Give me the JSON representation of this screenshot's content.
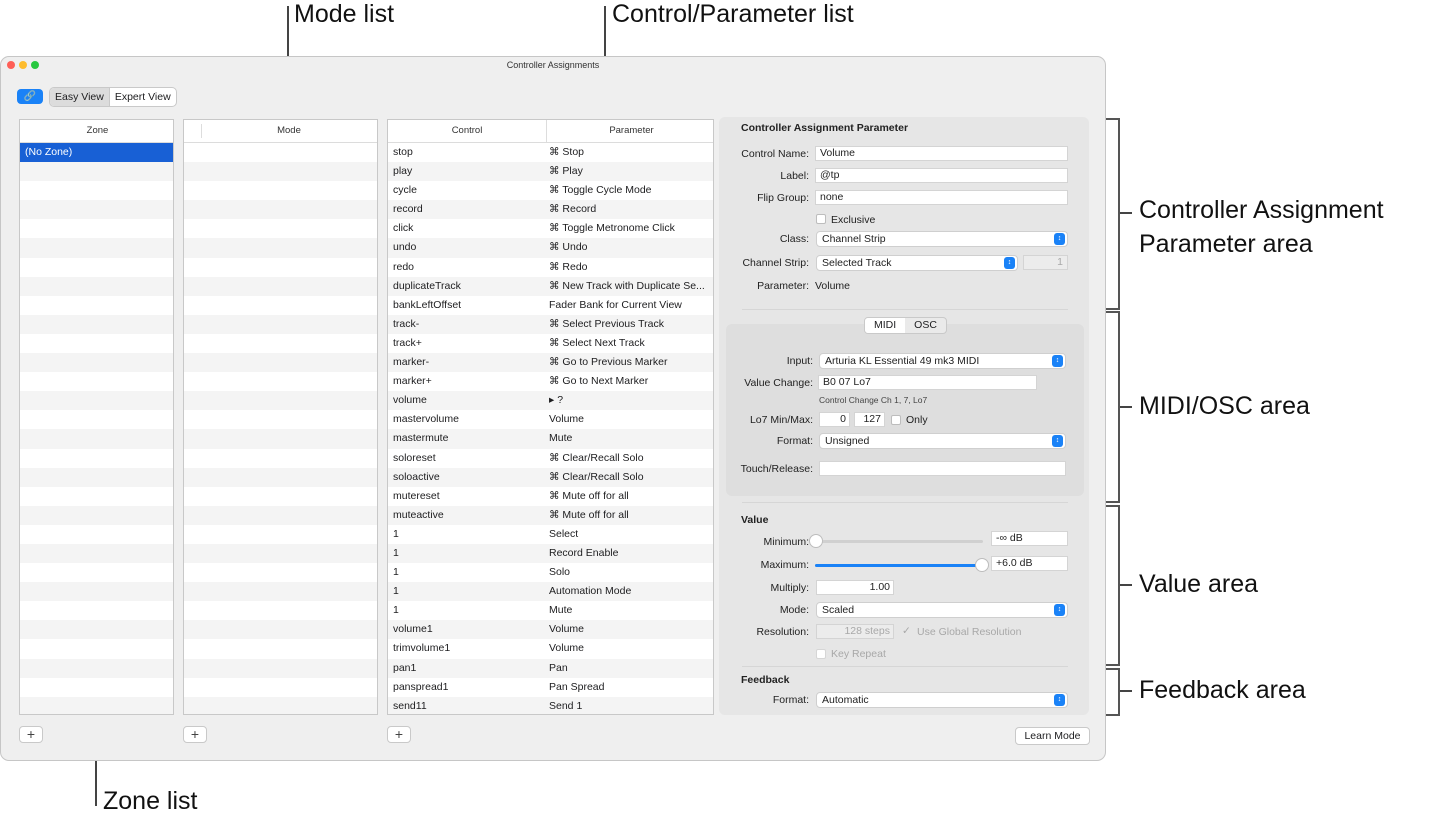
{
  "callouts": {
    "mode_list": "Mode list",
    "control_list": "Control/Parameter list",
    "cap_area_1": "Controller Assignment",
    "cap_area_2": "Parameter area",
    "midi_area": "MIDI/OSC area",
    "value_area": "Value area",
    "feedback_area": "Feedback area",
    "zone_list": "Zone list"
  },
  "window": {
    "title": "Controller Assignments"
  },
  "toolbar": {
    "link_icon": "link-icon",
    "easy_view": "Easy View",
    "expert_view": "Expert View"
  },
  "zone": {
    "header": "Zone",
    "items": [
      "(No Zone)"
    ]
  },
  "mode": {
    "header": "Mode"
  },
  "controls": {
    "header_control": "Control",
    "header_parameter": "Parameter",
    "rows": [
      {
        "control": "stop",
        "parameter": "⌘ Stop"
      },
      {
        "control": "play",
        "parameter": "⌘ Play"
      },
      {
        "control": "cycle",
        "parameter": "⌘ Toggle Cycle Mode"
      },
      {
        "control": "record",
        "parameter": "⌘ Record"
      },
      {
        "control": "click",
        "parameter": "⌘ Toggle Metronome Click"
      },
      {
        "control": "undo",
        "parameter": "⌘ Undo"
      },
      {
        "control": "redo",
        "parameter": "⌘ Redo"
      },
      {
        "control": "duplicateTrack",
        "parameter": "⌘ New Track with Duplicate Se..."
      },
      {
        "control": "bankLeftOffset",
        "parameter": "Fader Bank for Current View"
      },
      {
        "control": "track-",
        "parameter": "⌘ Select Previous Track"
      },
      {
        "control": "track+",
        "parameter": "⌘ Select Next Track"
      },
      {
        "control": "marker-",
        "parameter": "⌘ Go to Previous Marker"
      },
      {
        "control": "marker+",
        "parameter": "⌘ Go to Next Marker"
      },
      {
        "control": "volume",
        "parameter": "▸ ?"
      },
      {
        "control": "mastervolume",
        "parameter": "Volume"
      },
      {
        "control": "mastermute",
        "parameter": "Mute"
      },
      {
        "control": "soloreset",
        "parameter": "⌘ Clear/Recall Solo"
      },
      {
        "control": "soloactive",
        "parameter": "⌘ Clear/Recall Solo"
      },
      {
        "control": "mutereset",
        "parameter": "⌘ Mute off for all"
      },
      {
        "control": "muteactive",
        "parameter": "⌘ Mute off for all"
      },
      {
        "control": "1",
        "parameter": "Select"
      },
      {
        "control": "1",
        "parameter": "Record Enable"
      },
      {
        "control": "1",
        "parameter": "Solo"
      },
      {
        "control": "1",
        "parameter": "Automation Mode"
      },
      {
        "control": "1",
        "parameter": "Mute"
      },
      {
        "control": "volume1",
        "parameter": "Volume"
      },
      {
        "control": "trimvolume1",
        "parameter": "Volume"
      },
      {
        "control": "pan1",
        "parameter": "Pan"
      },
      {
        "control": "panspread1",
        "parameter": "Pan Spread"
      },
      {
        "control": "send11",
        "parameter": "Send 1"
      }
    ]
  },
  "add_label": "+",
  "cap": {
    "title": "Controller Assignment Parameter",
    "control_name_label": "Control Name:",
    "control_name": "Volume",
    "label_label": "Label:",
    "label": "@tp",
    "flip_group_label": "Flip Group:",
    "flip_group": "none",
    "exclusive_label": "Exclusive",
    "class_label": "Class:",
    "class": "Channel Strip",
    "channel_strip_label": "Channel Strip:",
    "channel_strip": "Selected Track",
    "channel_strip_num": "1",
    "parameter_label": "Parameter:",
    "parameter": "Volume"
  },
  "midi": {
    "tab_midi": "MIDI",
    "tab_osc": "OSC",
    "input_label": "Input:",
    "input": "Arturia KL Essential 49 mk3 MIDI",
    "value_change_label": "Value Change:",
    "value_change": "B0 07 Lo7",
    "value_change_note": "Control Change Ch 1, 7, Lo7",
    "lo7_label": "Lo7 Min/Max:",
    "lo7_min": "0",
    "lo7_max": "127",
    "only_label": "Only",
    "format_label": "Format:",
    "format": "Unsigned",
    "touch_label": "Touch/Release:",
    "touch": ""
  },
  "value": {
    "title": "Value",
    "minimum_label": "Minimum:",
    "minimum": "-∞ dB",
    "minimum_level": 0,
    "maximum_label": "Maximum:",
    "maximum": "+6.0 dB",
    "maximum_level": 1,
    "multiply_label": "Multiply:",
    "multiply": "1.00",
    "mode_label": "Mode:",
    "mode": "Scaled",
    "resolution_label": "Resolution:",
    "resolution": "128 steps",
    "use_global": "Use Global Resolution",
    "key_repeat": "Key Repeat"
  },
  "feedback": {
    "title": "Feedback",
    "format_label": "Format:",
    "format": "Automatic"
  },
  "learn_mode": "Learn Mode",
  "colors": {
    "accent": "#1a82f7",
    "selection": "#1860d5"
  }
}
